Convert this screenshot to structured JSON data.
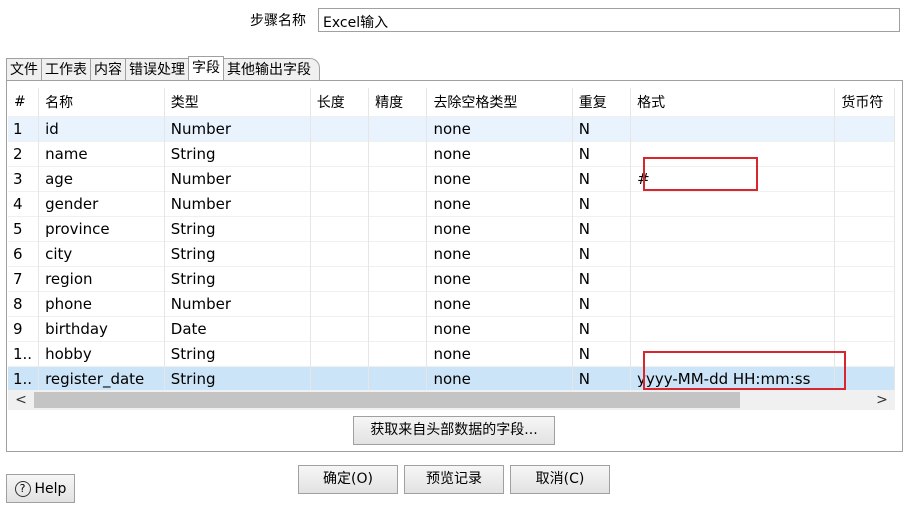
{
  "step": {
    "label": "步骤名称",
    "value": "Excel输入"
  },
  "tabs": [
    "文件",
    "工作表",
    "内容",
    "错误处理",
    "字段",
    "其他输出字段"
  ],
  "active_tab": "字段",
  "table": {
    "headers": [
      "#",
      "名称",
      "类型",
      "长度",
      "精度",
      "去除空格类型",
      "重复",
      "格式",
      "货币符"
    ],
    "rows": [
      {
        "n": "1",
        "name": "id",
        "type": "Number",
        "trim": "none",
        "repeat": "N",
        "format": ""
      },
      {
        "n": "2",
        "name": "name",
        "type": "String",
        "trim": "none",
        "repeat": "N",
        "format": ""
      },
      {
        "n": "3",
        "name": "age",
        "type": "Number",
        "trim": "none",
        "repeat": "N",
        "format": "#"
      },
      {
        "n": "4",
        "name": "gender",
        "type": "Number",
        "trim": "none",
        "repeat": "N",
        "format": ""
      },
      {
        "n": "5",
        "name": "province",
        "type": "String",
        "trim": "none",
        "repeat": "N",
        "format": ""
      },
      {
        "n": "6",
        "name": "city",
        "type": "String",
        "trim": "none",
        "repeat": "N",
        "format": ""
      },
      {
        "n": "7",
        "name": "region",
        "type": "String",
        "trim": "none",
        "repeat": "N",
        "format": ""
      },
      {
        "n": "8",
        "name": "phone",
        "type": "Number",
        "trim": "none",
        "repeat": "N",
        "format": ""
      },
      {
        "n": "9",
        "name": "birthday",
        "type": "Date",
        "trim": "none",
        "repeat": "N",
        "format": ""
      },
      {
        "n": "1..",
        "name": "hobby",
        "type": "String",
        "trim": "none",
        "repeat": "N",
        "format": ""
      },
      {
        "n": "1..",
        "name": "register_date",
        "type": "String",
        "trim": "none",
        "repeat": "N",
        "format": "yyyy-MM-dd HH:mm:ss"
      }
    ]
  },
  "buttons": {
    "get_fields": "获取来自头部数据的字段...",
    "help": "Help",
    "ok": "确定(O)",
    "preview": "预览记录",
    "cancel": "取消(C)"
  },
  "scroll": {
    "left_arrow": "<",
    "right_arrow": ">"
  },
  "colors": {
    "highlight": "#d9262e",
    "selected_row": "#cce4f7",
    "alt_row": "#e8f3fd"
  }
}
